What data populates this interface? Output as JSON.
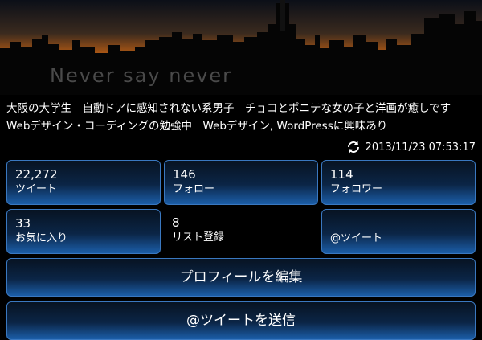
{
  "header": {
    "tagline": "Never say never"
  },
  "profile": {
    "bio": "大阪の大学生　自動ドアに感知されない系男子　チョコとポニテな女の子と洋画が癒しです　Webデザイン・コーディングの勉強中　Webデザイン, WordPressに興味あり",
    "updated": "2013/11/23 07:53:17"
  },
  "stats": {
    "tweets": {
      "value": "22,272",
      "label": "ツイート"
    },
    "following": {
      "value": "146",
      "label": "フォロー"
    },
    "followers": {
      "value": "114",
      "label": "フォロワー"
    },
    "favorites": {
      "value": "33",
      "label": "お気に入り"
    },
    "lists": {
      "value": "8",
      "label": "リスト登録"
    },
    "mentions": {
      "value": "",
      "label": "@ツイート"
    }
  },
  "actions": {
    "edit_profile": "プロフィールを編集",
    "send_mention": "@ツイートを送信"
  },
  "icons": {
    "refresh": "refresh-icon"
  },
  "colors": {
    "accent": "#3a78c0",
    "tile_bottom": "#1b5ea8"
  }
}
